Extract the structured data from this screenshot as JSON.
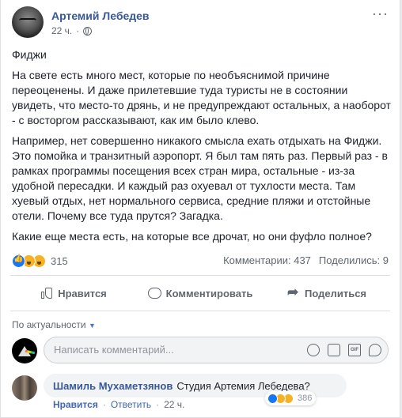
{
  "post": {
    "author": "Артемий Лебедев",
    "time": "22 ч.",
    "more": "···",
    "paragraphs": [
      "Фиджи",
      "На свете есть много мест, которые по необъяснимой причине переоценены. И даже прилетевшие туда туристы не в состоянии увидеть, что место-то дрянь, и не предупреждают остальных, а наоборот - с восторгом рассказывают, как им было клево.",
      "Например, нет совершенно никакого смысла ехать отдыхать на Фиджи. Это помойка и транзитный аэропорт. Я был там пять раз. Первый раз - в рамках программы посещения всех стран мира, остальные - из-за удобной пересадки. И каждый раз охуевал от тухлости места. Там хуевый отдых, нет нормального сервиса, средние пляжи и отстойные отели. Почему все туда прутся? Загадка.",
      "Какие еще места есть, на которые все дрочат, но они фуфло полное?"
    ]
  },
  "stats": {
    "reactions": "315",
    "comments": "Комментарии: 437",
    "shares": "Поделились: 9"
  },
  "actions": {
    "like": "Нравится",
    "comment": "Комментировать",
    "share": "Поделиться"
  },
  "sort": {
    "label": "По актуальности",
    "caret": "▼"
  },
  "composer": {
    "placeholder": "Написать комментарий...",
    "gif_label": "GIF"
  },
  "comment": {
    "author": "Шамиль Мухаметзянов",
    "text": "Студия Артемия Лебедева?",
    "reactions": "386",
    "like": "Нравится",
    "reply": "Ответить",
    "time": "22 ч.",
    "sep": "·"
  }
}
